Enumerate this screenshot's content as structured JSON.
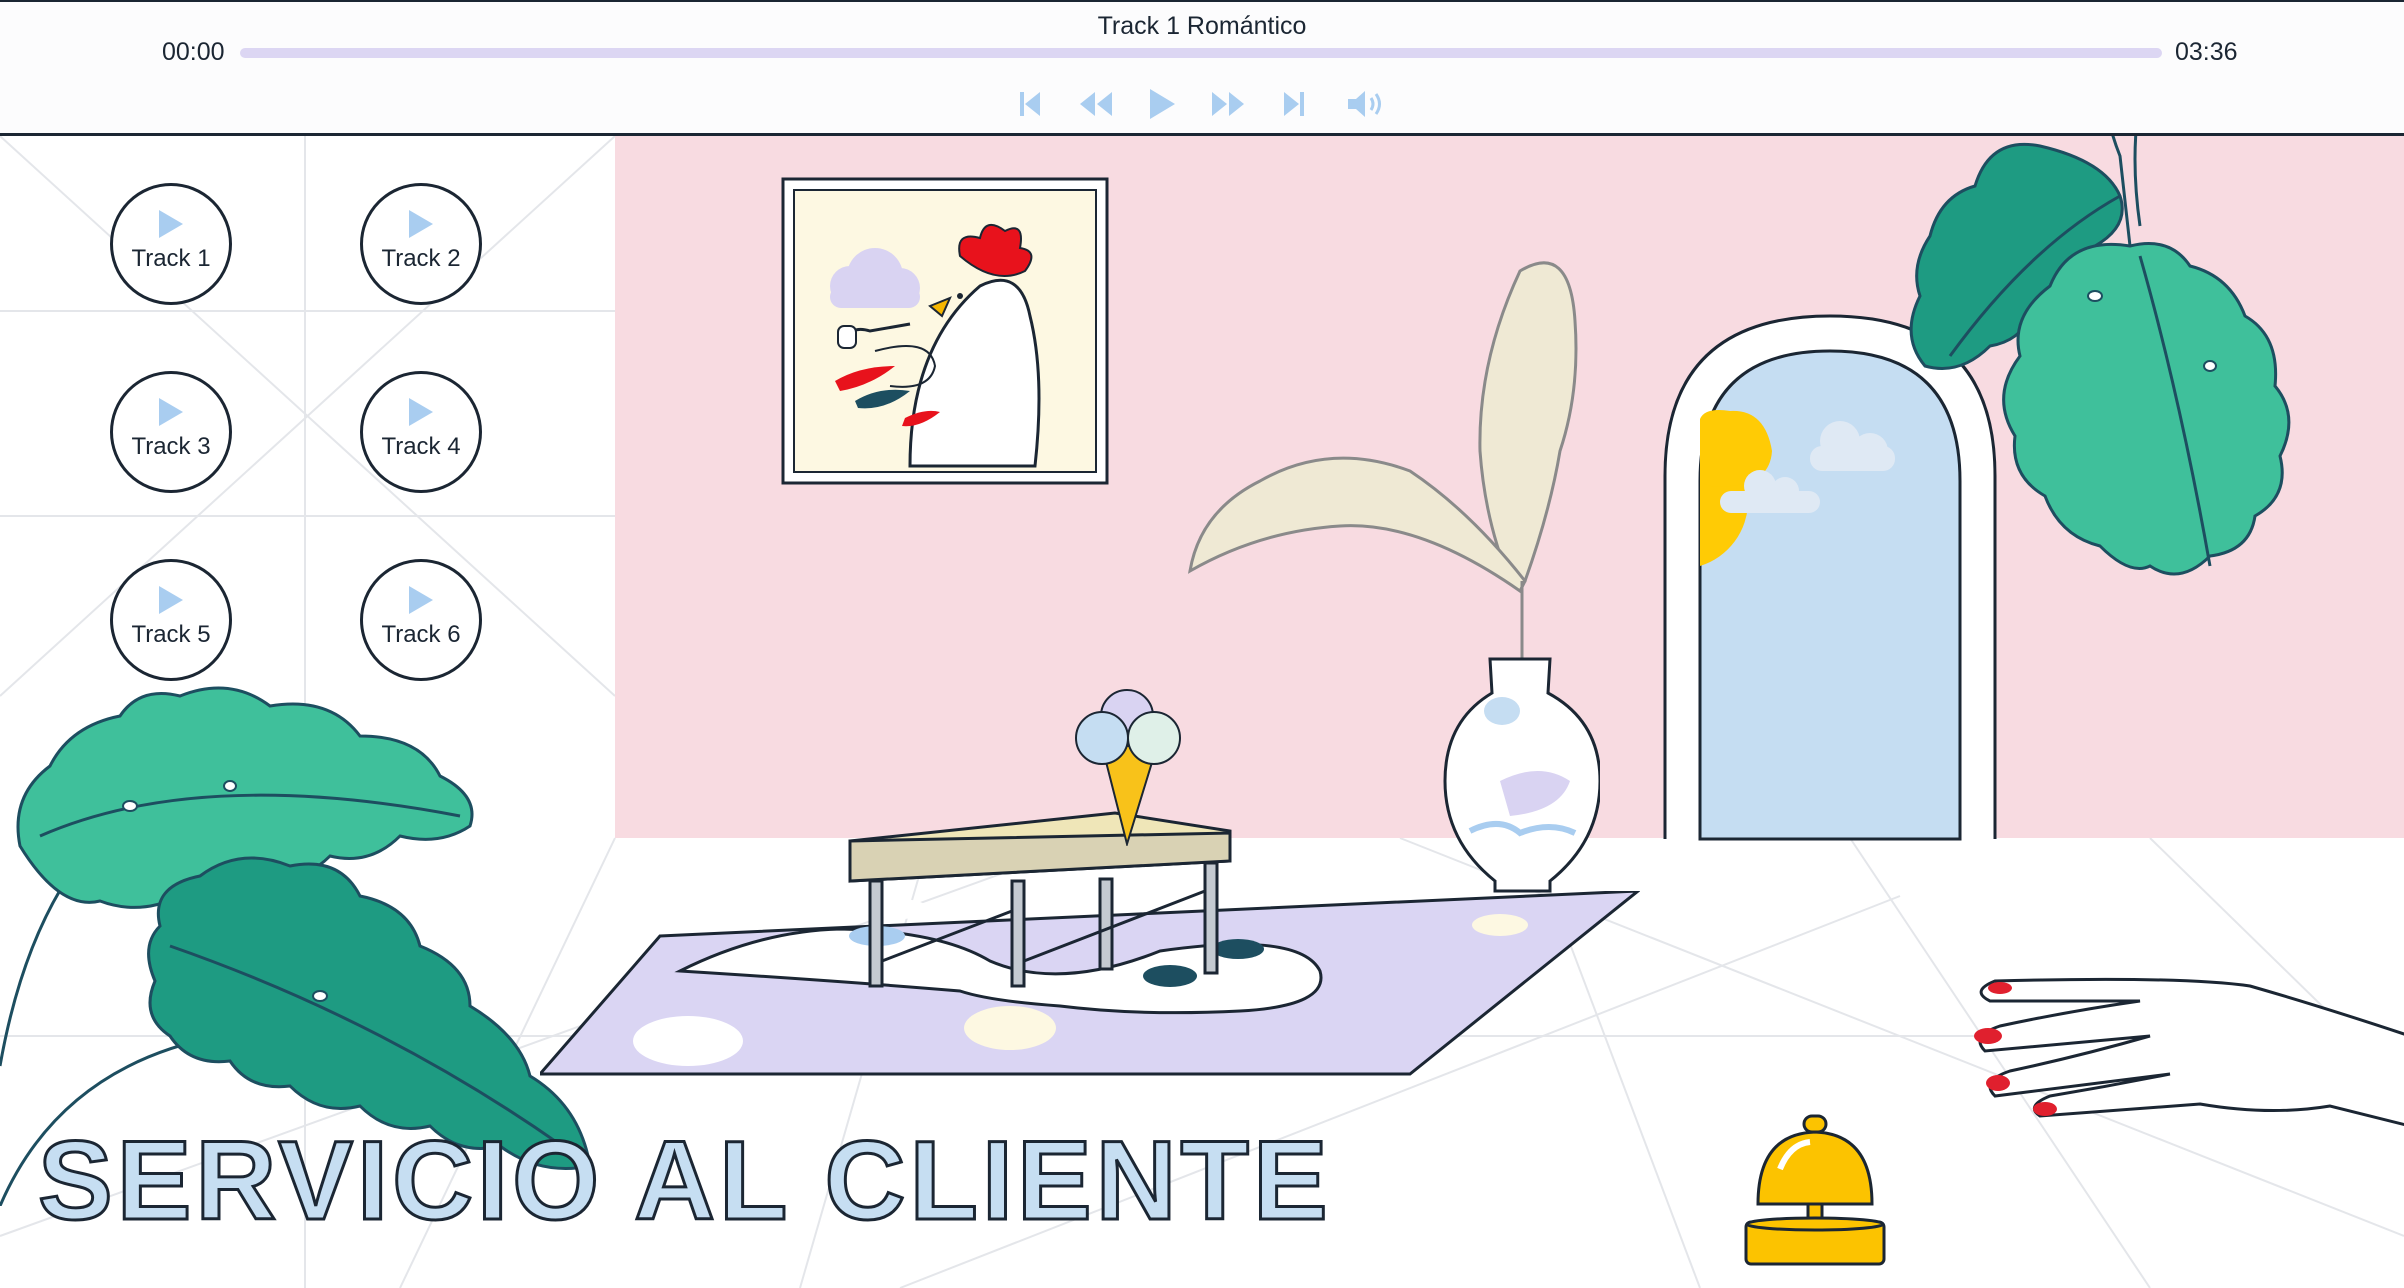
{
  "player": {
    "track_title": "Track 1 Romántico",
    "current_time": "00:00",
    "duration": "03:36",
    "progress": 0,
    "icons": [
      "skip-back-icon",
      "rewind-icon",
      "play-icon",
      "fast-forward-icon",
      "skip-forward-icon",
      "volume-icon"
    ]
  },
  "tracks": [
    {
      "label": "Track 1"
    },
    {
      "label": "Track 2"
    },
    {
      "label": "Track 3"
    },
    {
      "label": "Track 4"
    },
    {
      "label": "Track 5"
    },
    {
      "label": "Track 6"
    }
  ],
  "headline": "SERVICIO AL CLIENTE",
  "colors": {
    "wall": "#f8dbe1",
    "accent_blue": "#c6def2",
    "icon_blue": "#a9cdf0",
    "ink": "#1b2633",
    "leaf_green": "#3fc09b",
    "rug_lavender": "#dad5f3",
    "bell_yellow": "#fcc300",
    "nail_red": "#e0202e"
  }
}
